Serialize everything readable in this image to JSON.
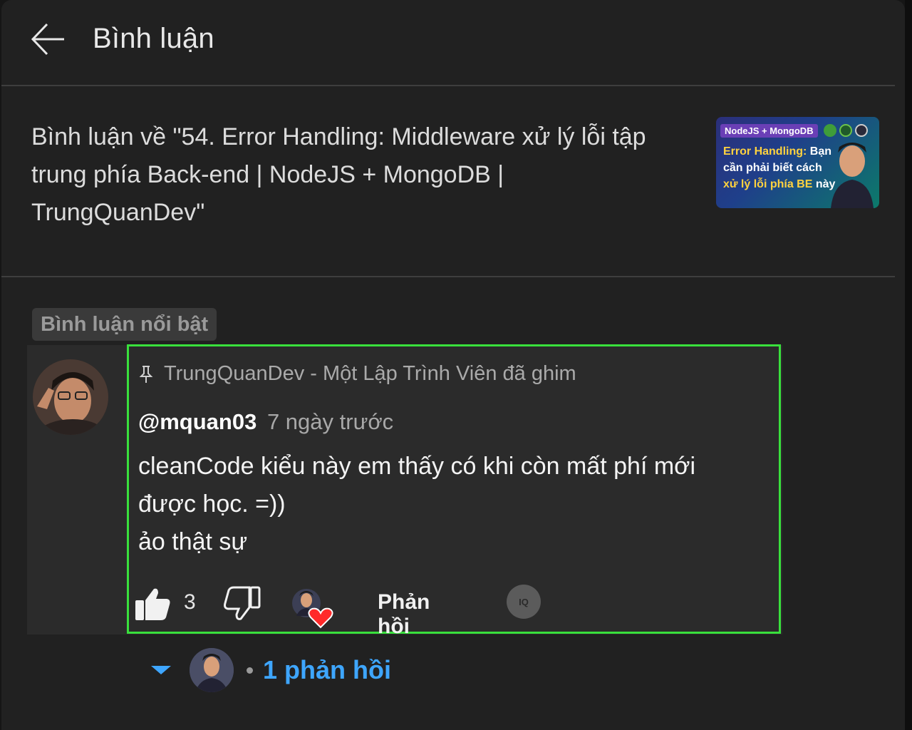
{
  "header": {
    "title": "Bình luận",
    "back_icon": "arrow-left-icon"
  },
  "video": {
    "title": "Bình luận về \"54. Error Handling: Middleware xử lý lỗi tập trung phía Back-end | NodeJS + MongoDB | TrungQuanDev\"",
    "thumbnail": {
      "tag": "NodeJS + MongoDB",
      "line1_highlight": "Error Handling:",
      "line1_rest": " Bạn",
      "line2": "cần phải biết cách",
      "line3_highlight": "xử lý lỗi phía BE",
      "line3_rest": " này"
    }
  },
  "filter_chip": "Bình luận nổi bật",
  "comment": {
    "pinned_text": "TrungQuanDev - Một Lập Trình Viên đã ghim",
    "author": "@mquan03",
    "time": "7 ngày trước",
    "text_lines": [
      "cleanCode kiểu này em thấy có khi còn mất phí mới",
      "được học. =))",
      "ảo thật sự"
    ],
    "like_count": "3",
    "reply_label": "Phản hồi",
    "iq_label": "IQ"
  },
  "replies": {
    "count_label": "1 phản hồi"
  },
  "colors": {
    "background": "#212121",
    "highlight_border": "#39e03c",
    "link_blue": "#3ea6ff",
    "heart": "#ff2a2a"
  }
}
